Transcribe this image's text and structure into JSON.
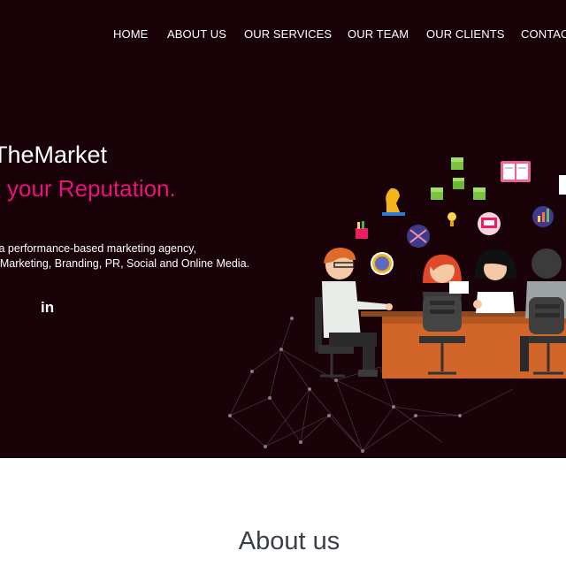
{
  "nav": {
    "items": [
      "HOME",
      "ABOUT US",
      "OUR SERVICES",
      "OUR TEAM",
      "OUR CLIENTS",
      "CONTAC"
    ]
  },
  "hero": {
    "title": "TheMarket",
    "subtitle": "your Reputation.",
    "description_line1": "is a performance-based marketing agency,",
    "description_line2": "nt Marketing, Branding, PR, Social and Online Media.",
    "linkedin_label": "in"
  },
  "about": {
    "title": "About us"
  },
  "colors": {
    "hero_background": "#1a0209",
    "accent_pink": "#e8147a",
    "heading_text": "#3b3f4a"
  },
  "icons": [
    "linkedin-icon",
    "team-meeting-illustration",
    "chess-knight-icon",
    "cube-icon",
    "book-icon",
    "lightbulb-icon",
    "chart-icon"
  ]
}
